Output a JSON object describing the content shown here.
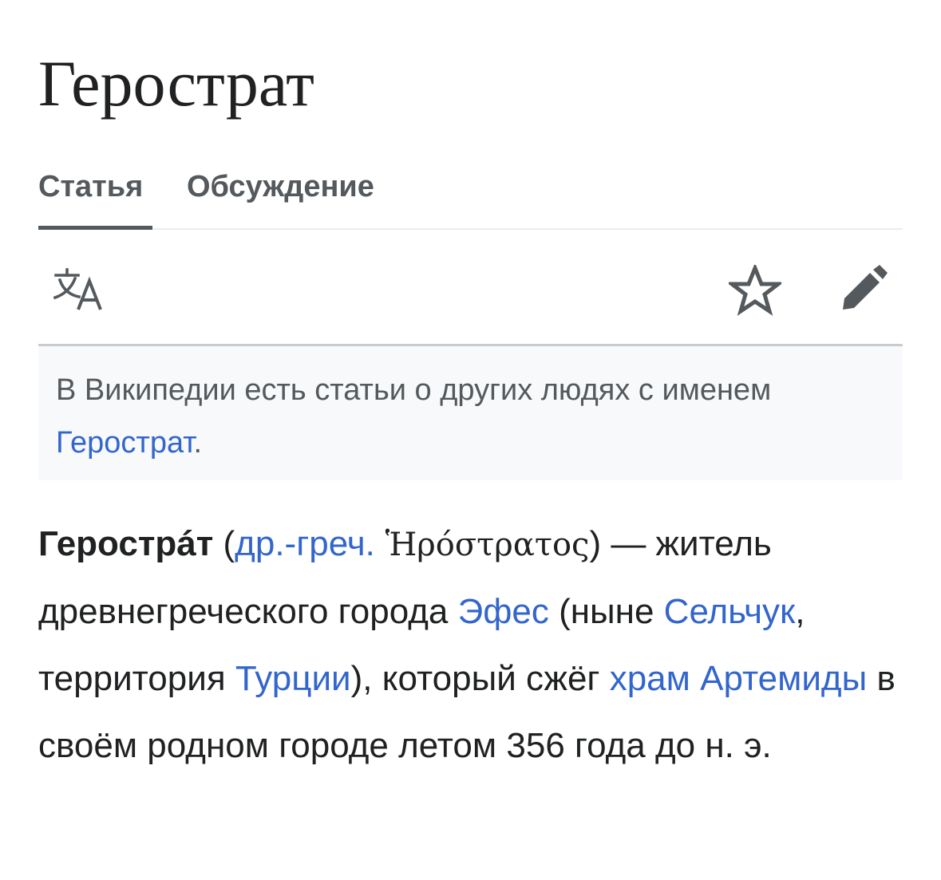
{
  "page": {
    "title": "Герострат"
  },
  "tabs": [
    {
      "label": "Статья",
      "selected": true
    },
    {
      "label": "Обсуждение",
      "selected": false
    }
  ],
  "toolbar": {
    "language_icon": "language-translate-icon",
    "watch_icon": "star-icon",
    "edit_icon": "pencil-icon"
  },
  "hatnote": {
    "text": "В Википедии есть статьи о других людях с именем ",
    "link": "Герострат",
    "end": "."
  },
  "lead": {
    "bold_name": "Герострáт",
    "open_paren": " (",
    "lang_link": "др.-греч.",
    "greek": " Ἡρόστρατος",
    "close_dash": ") — житель древнегреческого города ",
    "link_ephesus": "Эфес",
    "text_now": " (ныне ",
    "link_selcuk": "Сельчук",
    "text_territory": ", территория ",
    "link_turkey": "Турции",
    "text_burned": "), который сжёг ",
    "link_temple": "храм Артемиды",
    "text_end": " в своём родном городе летом 356 года до н. э."
  },
  "colors": {
    "link": "#3366cc",
    "text": "#202122",
    "muted": "#54595d",
    "hatnote_bg": "#f8f9fa"
  }
}
